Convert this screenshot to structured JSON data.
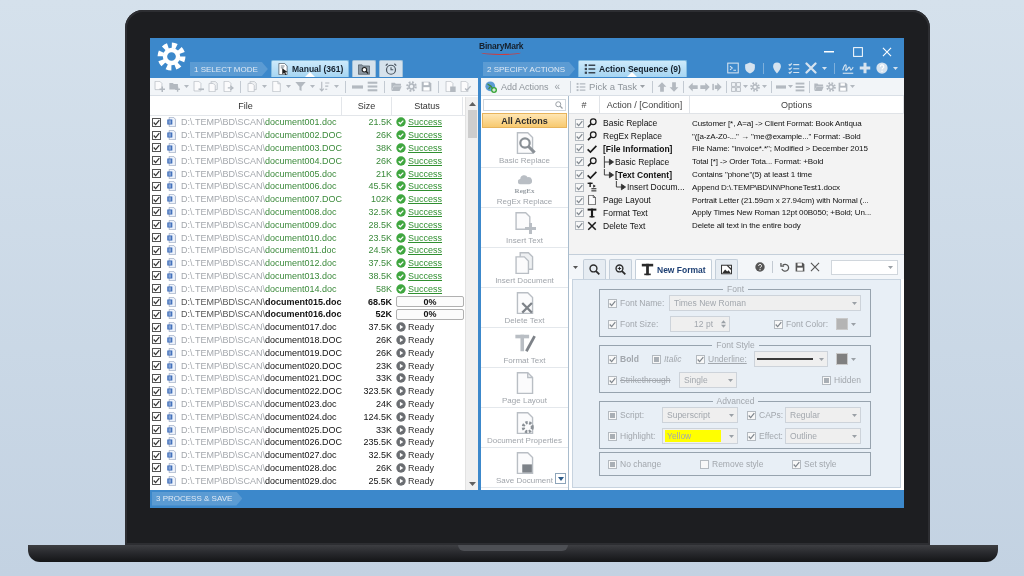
{
  "window": {
    "logo": "BinaryMark"
  },
  "steps": [
    {
      "label": "1 SELECT MODE"
    },
    {
      "label": "2 SPECIFY ACTIONS"
    },
    {
      "label": "3 PROCESS & SAVE"
    }
  ],
  "mode_tabs": [
    {
      "label": "Manual (361)",
      "selected": true
    },
    {
      "selected": false
    },
    {
      "selected": false
    }
  ],
  "action_tabs": [
    {
      "label": "Action Sequence (9)",
      "selected": true
    }
  ],
  "file_list": {
    "columns": [
      "File",
      "Size",
      "Status"
    ],
    "rows": [
      {
        "checked": true,
        "folder": "D:\\.TEMP\\BD\\SCAN\\",
        "name": "document001.doc",
        "size": "21.5K",
        "kind": "done",
        "status": "Success"
      },
      {
        "checked": true,
        "folder": "D:\\.TEMP\\BD\\SCAN\\",
        "name": "document002.DOC",
        "size": "26K",
        "kind": "done",
        "status": "Success"
      },
      {
        "checked": true,
        "folder": "D:\\.TEMP\\BD\\SCAN\\",
        "name": "document003.DOC",
        "size": "38K",
        "kind": "done",
        "status": "Success"
      },
      {
        "checked": true,
        "folder": "D:\\.TEMP\\BD\\SCAN\\",
        "name": "document004.DOC",
        "size": "26K",
        "kind": "done",
        "status": "Success"
      },
      {
        "checked": true,
        "folder": "D:\\.TEMP\\BD\\SCAN\\",
        "name": "document005.doc",
        "size": "21K",
        "kind": "done",
        "status": "Success"
      },
      {
        "checked": true,
        "folder": "D:\\.TEMP\\BD\\SCAN\\",
        "name": "document006.doc",
        "size": "45.5K",
        "kind": "done",
        "status": "Success"
      },
      {
        "checked": true,
        "folder": "D:\\.TEMP\\BD\\SCAN\\",
        "name": "document007.DOC",
        "size": "102K",
        "kind": "done",
        "status": "Success"
      },
      {
        "checked": true,
        "folder": "D:\\.TEMP\\BD\\SCAN\\",
        "name": "document008.doc",
        "size": "32.5K",
        "kind": "done",
        "status": "Success"
      },
      {
        "checked": true,
        "folder": "D:\\.TEMP\\BD\\SCAN\\",
        "name": "document009.doc",
        "size": "28.5K",
        "kind": "done",
        "status": "Success"
      },
      {
        "checked": true,
        "folder": "D:\\.TEMP\\BD\\SCAN\\",
        "name": "document010.doc",
        "size": "23.5K",
        "kind": "done",
        "status": "Success"
      },
      {
        "checked": true,
        "folder": "D:\\.TEMP\\BD\\SCAN\\",
        "name": "document011.doc",
        "size": "24.5K",
        "kind": "done",
        "status": "Success"
      },
      {
        "checked": true,
        "folder": "D:\\.TEMP\\BD\\SCAN\\",
        "name": "document012.doc",
        "size": "37.5K",
        "kind": "done",
        "status": "Success"
      },
      {
        "checked": true,
        "folder": "D:\\.TEMP\\BD\\SCAN\\",
        "name": "document013.doc",
        "size": "38.5K",
        "kind": "done",
        "status": "Success"
      },
      {
        "checked": true,
        "folder": "D:\\.TEMP\\BD\\SCAN\\",
        "name": "document014.doc",
        "size": "58K",
        "kind": "done",
        "status": "Success"
      },
      {
        "checked": true,
        "folder": "D:\\.TEMP\\BD\\SCAN\\",
        "name": "document015.doc",
        "size": "68.5K",
        "kind": "running",
        "status": "0%",
        "level": 0
      },
      {
        "checked": true,
        "folder": "D:\\.TEMP\\BD\\SCAN\\",
        "name": "document016.doc",
        "size": "52K",
        "kind": "running",
        "status": "0%",
        "level": 0
      },
      {
        "checked": true,
        "folder": "D:\\.TEMP\\BD\\SCAN\\",
        "name": "document017.doc",
        "size": "37.5K",
        "kind": "ready",
        "status": "Ready"
      },
      {
        "checked": true,
        "folder": "D:\\.TEMP\\BD\\SCAN\\",
        "name": "document018.DOC",
        "size": "26K",
        "kind": "ready",
        "status": "Ready"
      },
      {
        "checked": true,
        "folder": "D:\\.TEMP\\BD\\SCAN\\",
        "name": "document019.DOC",
        "size": "26K",
        "kind": "ready",
        "status": "Ready"
      },
      {
        "checked": true,
        "folder": "D:\\.TEMP\\BD\\SCAN\\",
        "name": "document020.DOC",
        "size": "23K",
        "kind": "ready",
        "status": "Ready"
      },
      {
        "checked": true,
        "folder": "D:\\.TEMP\\BD\\SCAN\\",
        "name": "document021.DOC",
        "size": "33K",
        "kind": "ready",
        "status": "Ready"
      },
      {
        "checked": true,
        "folder": "D:\\.TEMP\\BD\\SCAN\\",
        "name": "document022.DOC",
        "size": "323.5K",
        "kind": "ready",
        "status": "Ready"
      },
      {
        "checked": true,
        "folder": "D:\\.TEMP\\BD\\SCAN\\",
        "name": "document023.doc",
        "size": "24K",
        "kind": "ready",
        "status": "Ready"
      },
      {
        "checked": true,
        "folder": "D:\\.TEMP\\BD\\SCAN\\",
        "name": "document024.doc",
        "size": "124.5K",
        "kind": "ready",
        "status": "Ready"
      },
      {
        "checked": true,
        "folder": "D:\\.TEMP\\BD\\SCAN\\",
        "name": "document025.DOC",
        "size": "33K",
        "kind": "ready",
        "status": "Ready"
      },
      {
        "checked": true,
        "folder": "D:\\.TEMP\\BD\\SCAN\\",
        "name": "document026.DOC",
        "size": "235.5K",
        "kind": "ready",
        "status": "Ready"
      },
      {
        "checked": true,
        "folder": "D:\\.TEMP\\BD\\SCAN\\",
        "name": "document027.doc",
        "size": "32.5K",
        "kind": "ready",
        "status": "Ready"
      },
      {
        "checked": true,
        "folder": "D:\\.TEMP\\BD\\SCAN\\",
        "name": "document028.doc",
        "size": "26K",
        "kind": "ready",
        "status": "Ready"
      },
      {
        "checked": true,
        "folder": "D:\\.TEMP\\BD\\SCAN\\",
        "name": "document029.doc",
        "size": "25.5K",
        "kind": "ready",
        "status": "Ready"
      }
    ]
  },
  "actions_palette": {
    "add_button": "Add Actions",
    "collapse_button": "«",
    "header": "All Actions",
    "disabled": true,
    "items": [
      {
        "kind": "replace",
        "label": "Basic Replace"
      },
      {
        "kind": "regex",
        "label": "RegEx Replace",
        "icon_text": "RegEx"
      },
      {
        "kind": "insert-text",
        "label": "Insert Text"
      },
      {
        "kind": "insert-document",
        "label": "Insert Document"
      },
      {
        "kind": "delete",
        "label": "Delete Text"
      },
      {
        "kind": "format",
        "label": "Format Text"
      },
      {
        "kind": "layout",
        "label": "Page Layout"
      },
      {
        "kind": "properties",
        "label": "Document Properties"
      },
      {
        "kind": "save",
        "label": "Save Document"
      }
    ]
  },
  "sequence": {
    "task_button": "Pick a Task",
    "columns": [
      "#",
      "Action / [Condition]",
      "Options"
    ],
    "rows": [
      {
        "kind": "replace",
        "checked": true,
        "name": "Basic Replace",
        "options": "Customer [*, A=a] -> Client Format: Book Antiqua"
      },
      {
        "kind": "replace",
        "checked": true,
        "name": "RegEx Replace",
        "options": "\"([a-zA-Z0-...\" → \"me@example...\" Format: -Bold"
      },
      {
        "kind": "condition",
        "checked": true,
        "name": "[File Information]",
        "options": "File Name: \"invoice*.*\"; Modified > December 2015",
        "children": [
          {
            "kind": "replace",
            "checked": true,
            "name": "Basic Replace",
            "options": "Total [*] -> Order Tota... Format: +Bold"
          },
          {
            "kind": "condition",
            "checked": true,
            "name": "[Text Content]",
            "options": "Contains \"phone\"(5) at least 1 time",
            "children": [
              {
                "kind": "insert",
                "checked": true,
                "name": "Insert Docum...",
                "options": "Append D:\\.TEMP\\BD\\IN\\PhoneTest1.docx"
              }
            ]
          }
        ]
      },
      {
        "kind": "layout",
        "checked": true,
        "name": "Page Layout",
        "options": "Portrait Letter (21.59cm x 27.94cm) with Normal (..."
      },
      {
        "kind": "format",
        "checked": true,
        "name": "Format Text",
        "options": "Apply Times New Roman 12pt 00B050; +Bold; Un..."
      },
      {
        "kind": "delete",
        "checked": true,
        "name": "Delete Text",
        "options": "Delete all text in the entire body"
      }
    ]
  },
  "format_editor": {
    "disabled": true,
    "tabs": [
      {
        "selected": false
      },
      {
        "selected": false
      },
      {
        "label": "New Format",
        "selected": true
      },
      {
        "selected": false
      }
    ],
    "groups": [
      {
        "title": "Font",
        "rows": [
          [
            {
              "kind": "check",
              "label": "Font Name:",
              "checked": true,
              "indeterminate": false
            },
            {
              "kind": "select",
              "value": "Times New Roman"
            }
          ],
          [
            {
              "kind": "check",
              "label": "Font Size:",
              "checked": true,
              "indeterminate": false
            },
            {
              "kind": "spinner",
              "value": "12 pt"
            },
            {
              "kind": "check",
              "label": "Font Color:",
              "checked": true,
              "indeterminate": false
            },
            {
              "kind": "swatch",
              "color": "#b4b4b4"
            }
          ]
        ]
      },
      {
        "title": "Font Style",
        "rows": [
          [
            {
              "kind": "check",
              "label": "Bold",
              "checked": true,
              "indeterminate": false
            },
            {
              "kind": "check",
              "label": "Italic",
              "checked": false,
              "indeterminate": true
            },
            {
              "kind": "check",
              "label": "Underline:",
              "checked": true,
              "indeterminate": false
            },
            {
              "kind": "line"
            },
            {
              "kind": "swatch",
              "color": "#808080"
            }
          ],
          [
            {
              "kind": "check",
              "label": "Strikethrough",
              "checked": true,
              "indeterminate": false
            },
            {
              "kind": "select",
              "value": "Single"
            },
            {
              "kind": "check",
              "label": "Hidden",
              "checked": false,
              "indeterminate": true
            }
          ]
        ]
      },
      {
        "title": "Advanced",
        "rows": [
          [
            {
              "kind": "check",
              "label": "Script:",
              "checked": false,
              "indeterminate": true
            },
            {
              "kind": "select",
              "value": "Superscript"
            },
            {
              "kind": "check",
              "label": "CAPs:",
              "checked": true,
              "indeterminate": false
            },
            {
              "kind": "select",
              "value": "Regular"
            }
          ],
          [
            {
              "kind": "check",
              "label": "Highlight:",
              "checked": false,
              "indeterminate": true
            },
            {
              "kind": "select",
              "value": "Yellow",
              "color": "#ffff00"
            },
            {
              "kind": "check",
              "label": "Effect:",
              "checked": true,
              "indeterminate": false
            },
            {
              "kind": "select",
              "value": "Outline"
            }
          ]
        ]
      },
      {
        "rows": [
          [
            {
              "kind": "check",
              "label": "No change",
              "checked": false,
              "indeterminate": true
            },
            {
              "kind": "check",
              "label": "Remove style",
              "checked": false,
              "indeterminate": false
            },
            {
              "kind": "check",
              "label": "Set style",
              "checked": true,
              "indeterminate": false
            }
          ]
        ]
      }
    ]
  }
}
